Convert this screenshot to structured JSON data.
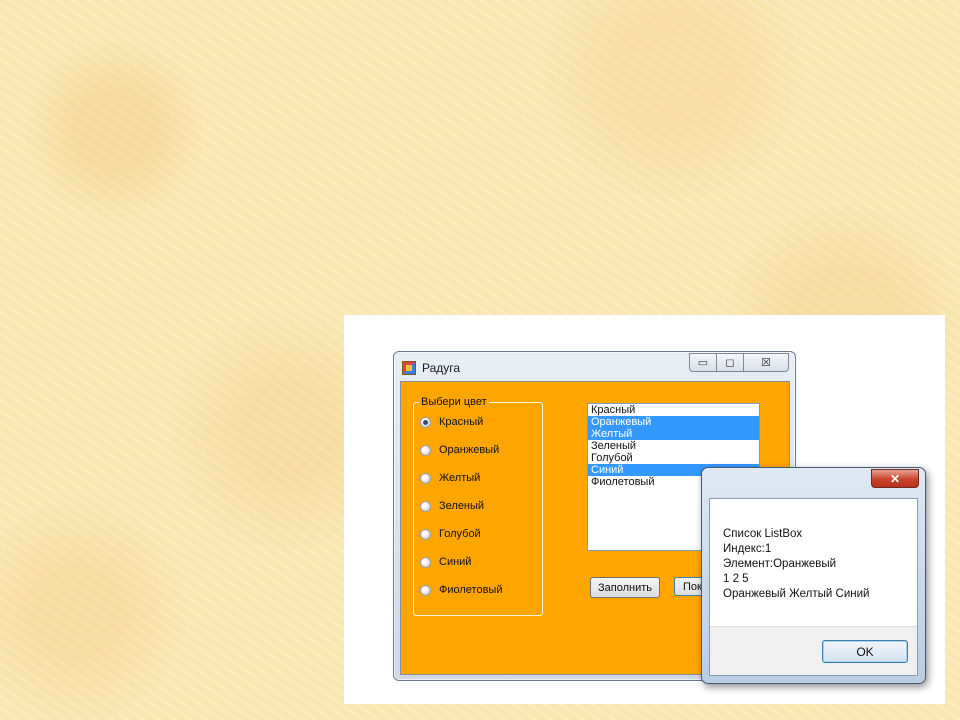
{
  "window": {
    "title": "Радуга",
    "minimize_glyph": "▭",
    "maximize_glyph": "◻",
    "close_glyph": "☒"
  },
  "groupbox": {
    "legend": "Выбери цвет",
    "radios": [
      {
        "label": "Красный",
        "checked": true
      },
      {
        "label": "Оранжевый",
        "checked": false
      },
      {
        "label": "Желтый",
        "checked": false
      },
      {
        "label": "Зеленый",
        "checked": false
      },
      {
        "label": "Голубой",
        "checked": false
      },
      {
        "label": "Синий",
        "checked": false
      },
      {
        "label": "Фиолетовый",
        "checked": false
      }
    ]
  },
  "listbox": {
    "items": [
      {
        "label": "Красный",
        "selected": false
      },
      {
        "label": "Оранжевый",
        "selected": true
      },
      {
        "label": "Желтый",
        "selected": true
      },
      {
        "label": "Зеленый",
        "selected": false
      },
      {
        "label": "Голубой",
        "selected": false
      },
      {
        "label": "Синий",
        "selected": true
      },
      {
        "label": "Фиолетовый",
        "selected": false
      }
    ]
  },
  "buttons": {
    "fill_label": "Заполнить",
    "show_label": "Пока"
  },
  "messagebox": {
    "close_glyph": "✕",
    "lines": [
      "Список ListBox",
      " Индекс:1",
      " Элемент:Оранжевый",
      " 1 2 5",
      " Оранжевый Желтый Синий"
    ],
    "ok_label": "OK"
  },
  "colors": {
    "form_background": "#ffa500",
    "selection": "#3399ff",
    "close_button": "#c9432b"
  }
}
